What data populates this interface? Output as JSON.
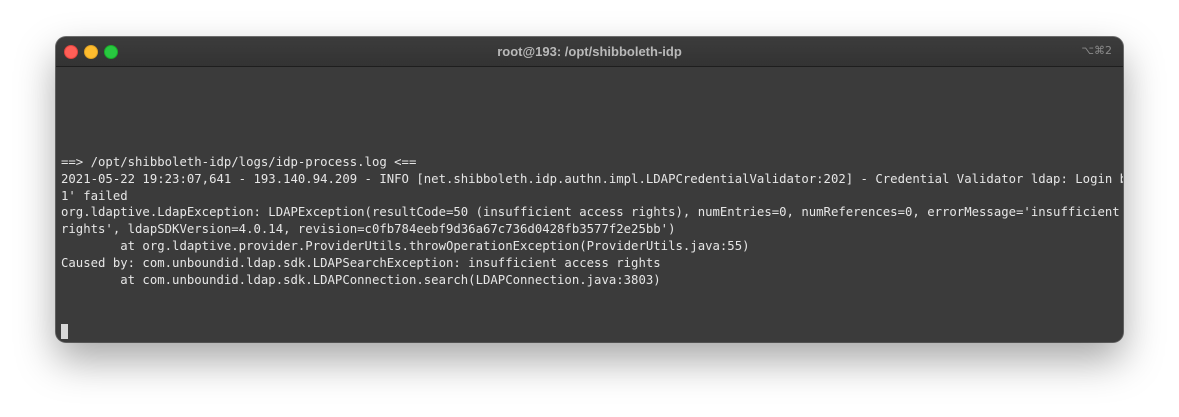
{
  "window": {
    "title": "root@193: /opt/shibboleth-idp",
    "shortcut": "⌥⌘2"
  },
  "terminal": {
    "lines": [
      "==> /opt/shibboleth-idp/logs/idp-process.log <==",
      "2021-05-22 19:23:07,641 - 193.140.94.209 - INFO [net.shibboleth.idp.authn.impl.LDAPCredentialValidator:202] - Credential Validator ldap: Login by 'user",
      "1' failed",
      "org.ldaptive.LdapException: LDAPException(resultCode=50 (insufficient access rights), numEntries=0, numReferences=0, errorMessage='insufficient access",
      "rights', ldapSDKVersion=4.0.14, revision=c0fb784eebf9d36a67c736d0428fb3577f2e25bb')",
      "        at org.ldaptive.provider.ProviderUtils.throwOperationException(ProviderUtils.java:55)",
      "Caused by: com.unboundid.ldap.sdk.LDAPSearchException: insufficient access rights",
      "        at com.unboundid.ldap.sdk.LDAPConnection.search(LDAPConnection.java:3803)"
    ]
  }
}
